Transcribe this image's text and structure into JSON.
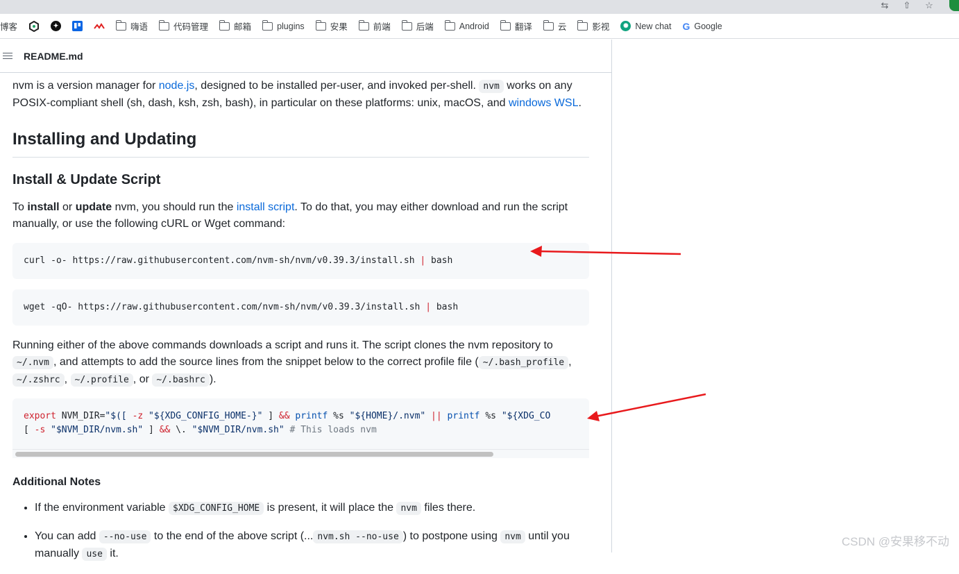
{
  "bookmarks": [
    {
      "label": "博客",
      "icon": "none"
    },
    {
      "label": "",
      "icon": "hexagon-logo-icon"
    },
    {
      "label": "",
      "icon": "compass-logo-icon"
    },
    {
      "label": "",
      "icon": "trello-logo-icon"
    },
    {
      "label": "",
      "icon": "wave-logo-icon"
    },
    {
      "label": "嗨语",
      "icon": "folder-icon"
    },
    {
      "label": "代码管理",
      "icon": "folder-icon"
    },
    {
      "label": "邮箱",
      "icon": "folder-icon"
    },
    {
      "label": "plugins",
      "icon": "folder-icon"
    },
    {
      "label": "安果",
      "icon": "folder-icon"
    },
    {
      "label": "前端",
      "icon": "folder-icon"
    },
    {
      "label": "后端",
      "icon": "folder-icon"
    },
    {
      "label": "Android",
      "icon": "folder-icon"
    },
    {
      "label": "翻译",
      "icon": "folder-icon"
    },
    {
      "label": "云",
      "icon": "folder-icon"
    },
    {
      "label": "影视",
      "icon": "folder-icon"
    },
    {
      "label": "New chat",
      "icon": "openai-logo-icon"
    },
    {
      "label": "Google",
      "icon": "google-logo-icon"
    }
  ],
  "readme": {
    "title": "README.md",
    "intro": {
      "t1": "nvm is a version manager for ",
      "link1": "node.js",
      "t2": ", designed to be installed per-user, and invoked per-shell. ",
      "code1": "nvm",
      "t3": " works on any POSIX-compliant shell (sh, dash, ksh, zsh, bash), in particular on these platforms: unix, macOS, and ",
      "link2": "windows WSL",
      "t4": "."
    },
    "h2": "Installing and Updating",
    "h3": "Install & Update Script",
    "install_para": {
      "t1": "To ",
      "b1": "install",
      "t2": " or ",
      "b2": "update",
      "t3": " nvm, you should run the ",
      "link": "install script",
      "t4": ". To do that, you may either download and run the script manually, or use the following cURL or Wget command:"
    },
    "curl_cmd": {
      "main": "curl -o- https://raw.githubusercontent.com/nvm-sh/nvm/v0.39.3/install.sh ",
      "pipe": "|",
      "tail": " bash"
    },
    "wget_cmd": {
      "main": "wget -qO- https://raw.githubusercontent.com/nvm-sh/nvm/v0.39.3/install.sh ",
      "pipe": "|",
      "tail": " bash"
    },
    "running_para": {
      "t1": "Running either of the above commands downloads a script and runs it. The script clones the nvm repository to ",
      "c1": "~/.nvm",
      "t2": ", and attempts to add the source lines from the snippet below to the correct profile file (",
      "c2": "~/.bash_profile",
      "s1": ", ",
      "c3": "~/.zshrc",
      "s2": ", ",
      "c4": "~/.profile",
      "s3": ", or ",
      "c5": "~/.bashrc",
      "t3": ")."
    },
    "export_block": {
      "l1_export": "export",
      "l1_a": " NVM_DIR=",
      "l1_b": "\"$([ ",
      "l1_z": "-z",
      "l1_c": " \"${XDG_CONFIG_HOME-}\"",
      "l1_d": " ] ",
      "l1_and": "&&",
      "l1_printf1": " printf",
      "l1_e": " %s ",
      "l1_f": "\"${HOME}/.nvm\"",
      "l1_or": " ||",
      "l1_printf2": " printf",
      "l1_g": " %s ",
      "l1_h": "\"${XDG_CO",
      "l2_a": "[ ",
      "l2_s": "-s",
      "l2_b": " \"$NVM_DIR/nvm.sh\"",
      "l2_c": " ] ",
      "l2_and": "&&",
      "l2_d": " \\. ",
      "l2_e": "\"$NVM_DIR/nvm.sh\"",
      "l2_cm": " # This loads nvm"
    },
    "h4": "Additional Notes",
    "note1": {
      "t1": "If the environment variable ",
      "c1": "$XDG_CONFIG_HOME",
      "t2": " is present, it will place the ",
      "c2": "nvm",
      "t3": " files there."
    },
    "note2": {
      "t1": "You can add ",
      "c1": "--no-use",
      "t2": " to the end of the above script (...",
      "c2": "nvm.sh --no-use",
      "t3": ") to postpone using ",
      "c3": "nvm",
      "t4": " until you manually ",
      "c4": "use",
      "t5": " it."
    }
  },
  "watermark": "CSDN @安果移不动",
  "colors": {
    "link": "#0969da",
    "arrow": "#e8191c",
    "code_bg": "#f6f8fa"
  }
}
